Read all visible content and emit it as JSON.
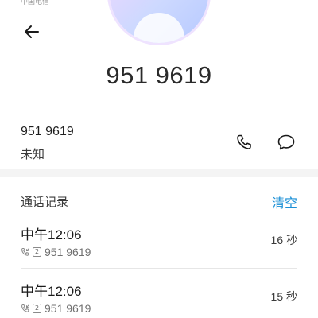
{
  "status_bar": {
    "carrier": "中国电信"
  },
  "header": {
    "back_icon": "arrow-left-icon",
    "avatar_icon": "person-avatar"
  },
  "contact": {
    "number_display": "951  9619",
    "number": "951  9619",
    "label": "未知"
  },
  "actions": {
    "call_icon": "phone-icon",
    "message_icon": "message-icon"
  },
  "call_log": {
    "title": "通话记录",
    "clear_label": "清空",
    "entries": [
      {
        "time": "中午12:06",
        "sim": "2",
        "number": "951  9619",
        "duration": "16 秒"
      },
      {
        "time": "中午12:06",
        "sim": "2",
        "number": "951  9619",
        "duration": "15 秒"
      }
    ]
  },
  "colors": {
    "accent": "#1a8fd6",
    "text_primary": "#1a1a1a",
    "text_secondary": "#707070"
  }
}
